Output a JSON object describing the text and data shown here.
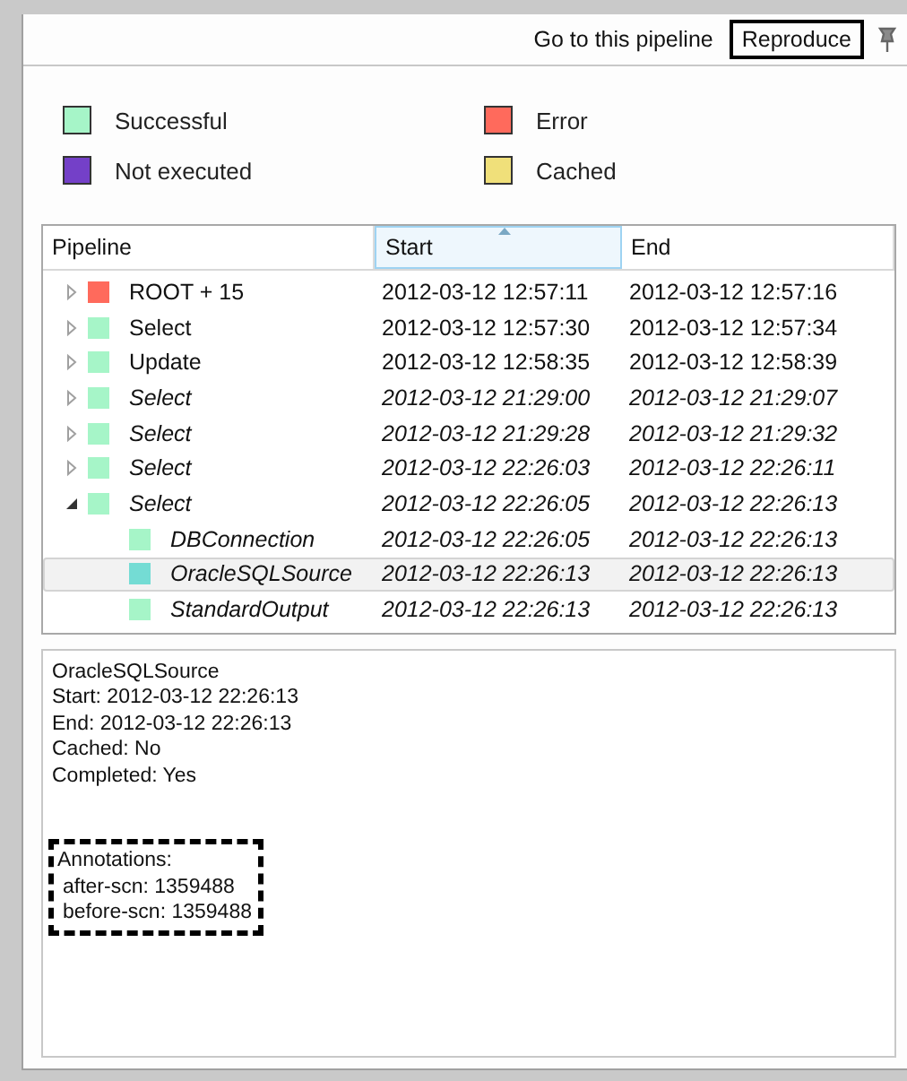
{
  "toolbar": {
    "actions": [
      {
        "label": "Go to this pipeline",
        "highlighted": false
      },
      {
        "label": "Reproduce",
        "highlighted": true
      }
    ]
  },
  "legend": [
    {
      "label": "Successful",
      "color": "#a6f5c8"
    },
    {
      "label": "Error",
      "color": "#ff6a5c"
    },
    {
      "label": "Not executed",
      "color": "#7440c8"
    },
    {
      "label": "Cached",
      "color": "#f0e07a"
    }
  ],
  "table": {
    "columns": [
      {
        "label": "Pipeline",
        "sorted": false
      },
      {
        "label": "Start",
        "sorted": true
      },
      {
        "label": "End",
        "sorted": false
      }
    ],
    "rows": [
      {
        "name": "ROOT + 15",
        "start": "2012-03-12 12:57:11",
        "end": "2012-03-12 12:57:16",
        "color": "#ff6a5c",
        "italic": false,
        "expanded": false,
        "selected": false
      },
      {
        "name": "Select",
        "start": "2012-03-12 12:57:30",
        "end": "2012-03-12 12:57:34",
        "color": "#a6f5c8",
        "italic": false,
        "expanded": false,
        "selected": false
      },
      {
        "name": "Update",
        "start": "2012-03-12 12:58:35",
        "end": "2012-03-12 12:58:39",
        "color": "#a6f5c8",
        "italic": false,
        "expanded": false,
        "selected": false
      },
      {
        "name": "Select",
        "start": "2012-03-12 21:29:00",
        "end": "2012-03-12 21:29:07",
        "color": "#a6f5c8",
        "italic": true,
        "expanded": false,
        "selected": false
      },
      {
        "name": "Select",
        "start": "2012-03-12 21:29:28",
        "end": "2012-03-12 21:29:32",
        "color": "#a6f5c8",
        "italic": true,
        "expanded": false,
        "selected": false
      },
      {
        "name": "Select",
        "start": "2012-03-12 22:26:03",
        "end": "2012-03-12 22:26:11",
        "color": "#a6f5c8",
        "italic": true,
        "expanded": false,
        "selected": false
      },
      {
        "name": "Select",
        "start": "2012-03-12 22:26:05",
        "end": "2012-03-12 22:26:13",
        "color": "#a6f5c8",
        "italic": true,
        "expanded": true,
        "selected": false,
        "children": [
          {
            "name": "DBConnection",
            "start": "2012-03-12 22:26:05",
            "end": "2012-03-12 22:26:13",
            "color": "#a6f5c8",
            "italic": true,
            "selected": false
          },
          {
            "name": "OracleSQLSource",
            "start": "2012-03-12 22:26:13",
            "end": "2012-03-12 22:26:13",
            "color": "#74dcd4",
            "italic": true,
            "selected": true
          },
          {
            "name": "StandardOutput",
            "start": "2012-03-12 22:26:13",
            "end": "2012-03-12 22:26:13",
            "color": "#a6f5c8",
            "italic": true,
            "selected": false
          }
        ]
      }
    ]
  },
  "details": {
    "lines": [
      "OracleSQLSource",
      "Start: 2012-03-12 22:26:13",
      "End: 2012-03-12 22:26:13",
      "Cached: No",
      "Completed: Yes"
    ],
    "annotations": {
      "heading": "Annotations:",
      "items": [
        "after-scn: 1359488",
        "before-scn: 1359488"
      ],
      "highlighted": true
    }
  }
}
